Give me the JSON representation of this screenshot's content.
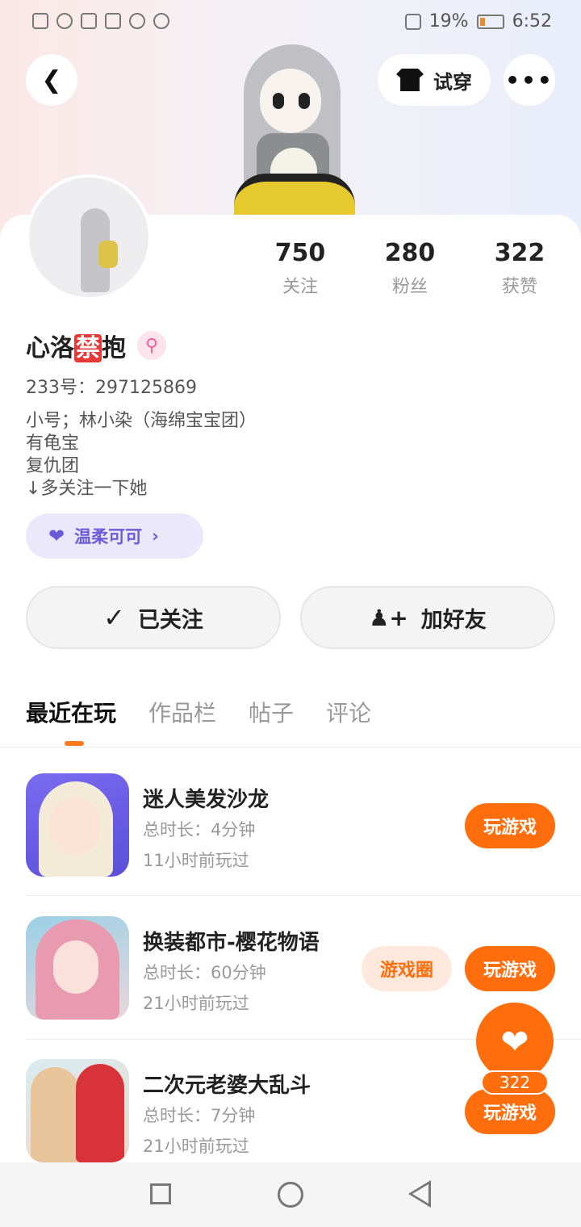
{
  "status_bar": {
    "battery": "19%",
    "time": "6:52"
  },
  "header": {
    "tryon_label": "试穿"
  },
  "profile": {
    "stats": [
      {
        "num": "750",
        "label": "关注"
      },
      {
        "num": "280",
        "label": "粉丝"
      },
      {
        "num": "322",
        "label": "获赞"
      }
    ],
    "name_part1": "心洛",
    "name_mid": "禁",
    "name_part2": "抱",
    "gender_symbol": "⚲",
    "uid": "233号：297125869",
    "bio": [
      "小号；林小染（海绵宝宝团）",
      "有龟宝",
      "复仇团",
      "↓多关注一下她"
    ],
    "tag_label": "温柔可可",
    "follow_label": "已关注",
    "friend_label": "加好友"
  },
  "tabs": [
    "最近在玩",
    "作品栏",
    "帖子",
    "评论"
  ],
  "games": [
    {
      "title": "迷人美发沙龙",
      "duration": "总时长：4分钟",
      "ago": "11小时前玩过",
      "play": "玩游戏"
    },
    {
      "title": "换装都市-樱花物语",
      "duration": "总时长：60分钟",
      "ago": "21小时前玩过",
      "play": "玩游戏",
      "circle": "游戏圈"
    },
    {
      "title": "二次元老婆大乱斗",
      "duration": "总时长：7分钟",
      "ago": "21小时前玩过",
      "play": "玩游戏"
    }
  ],
  "like": {
    "count": "322"
  },
  "colors": {
    "accent": "#ff6d0c",
    "tag_purple": "#6b5bd6"
  }
}
